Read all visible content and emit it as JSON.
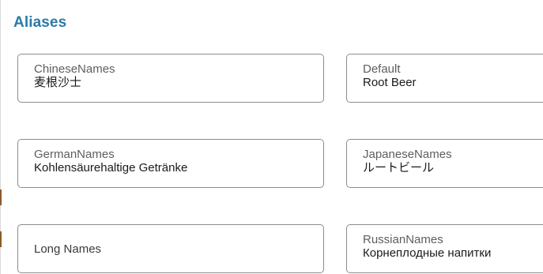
{
  "section": {
    "title": "Aliases"
  },
  "aliases": {
    "chinese": {
      "label": "ChineseNames",
      "value": "麦根沙士"
    },
    "default": {
      "label": "Default",
      "value": "Root Beer"
    },
    "german": {
      "label": "GermanNames",
      "value": "Kohlensäurehaltige Getränke"
    },
    "japanese": {
      "label": "JapaneseNames",
      "value": "ルートビール"
    },
    "long": {
      "label": "Long Names",
      "value": ""
    },
    "russian": {
      "label": "RussianNames",
      "value": "Корнеплодные напитки"
    }
  },
  "colors": {
    "title": "#2a7aa8",
    "border": "#8c8c8c",
    "label": "#5e5e5e",
    "value": "#1a1a1a"
  }
}
